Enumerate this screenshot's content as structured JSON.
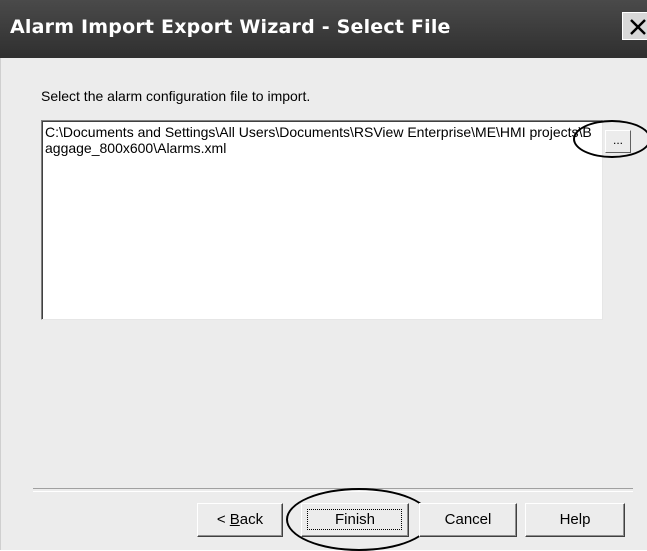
{
  "window": {
    "title": "Alarm Import Export Wizard - Select File"
  },
  "prompt": "Select the alarm configuration file to import.",
  "file_path": "C:\\Documents and Settings\\All Users\\Documents\\RSView Enterprise\\ME\\HMI projects\\Baggage_800x600\\Alarms.xml",
  "browse_label": "...",
  "buttons": {
    "back_prefix": "< ",
    "back_mnemonic": "B",
    "back_rest": "ack",
    "finish": "Finish",
    "cancel": "Cancel",
    "help": "Help"
  },
  "icons": {
    "close": "close-icon"
  }
}
